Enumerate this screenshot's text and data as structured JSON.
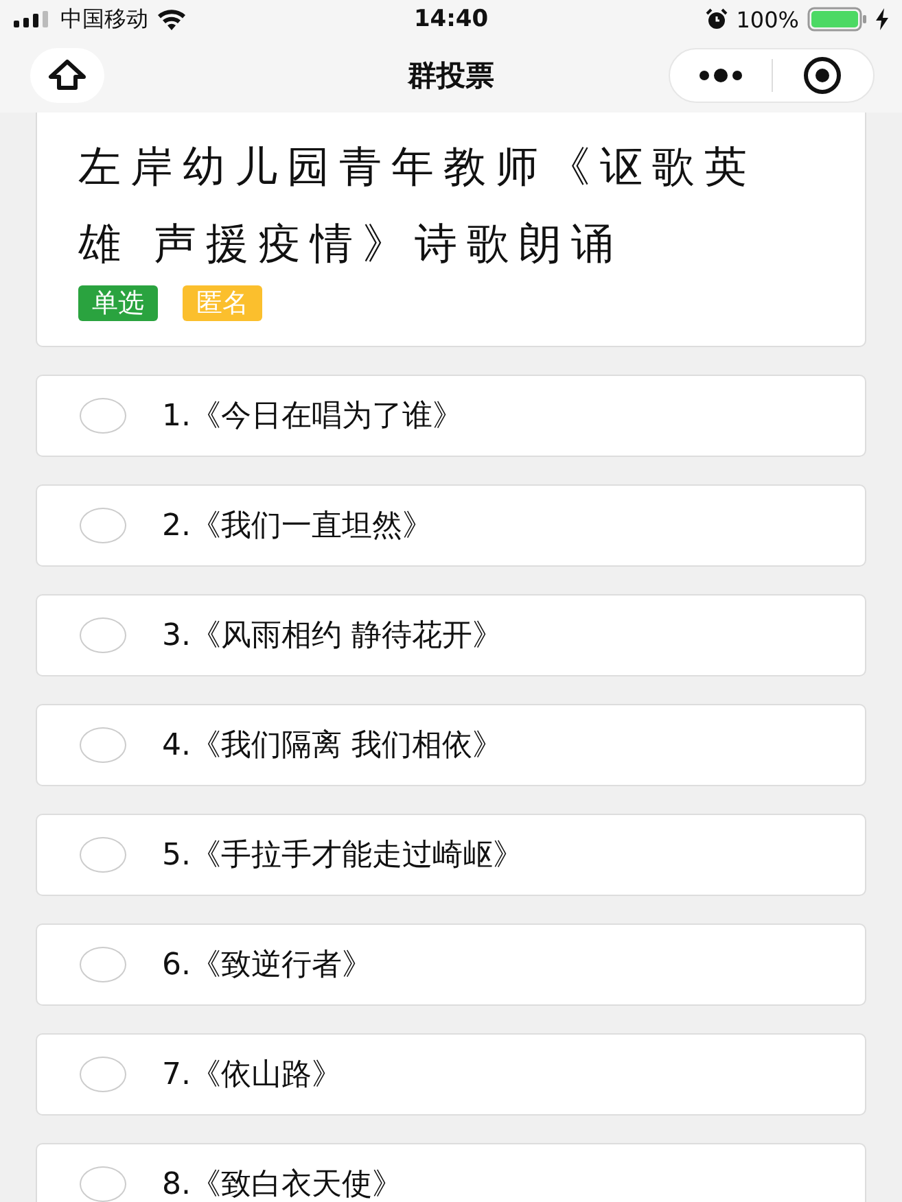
{
  "status_bar": {
    "carrier": "中国移动",
    "time": "14:40",
    "battery": "100%"
  },
  "nav": {
    "title": "群投票"
  },
  "poll": {
    "title": "左岸幼儿园青年教师《讴歌英雄 声援疫情》诗歌朗诵",
    "tags": [
      {
        "label": "单选",
        "color": "#2aa33f"
      },
      {
        "label": "匿名",
        "color": "#fbbf2d"
      }
    ]
  },
  "options": [
    {
      "label": "1.《今日在唱为了谁》",
      "selected": false
    },
    {
      "label": "2.《我们一直坦然》",
      "selected": false
    },
    {
      "label": "3.《风雨相约 静待花开》",
      "selected": false
    },
    {
      "label": "4.《我们隔离 我们相依》",
      "selected": false
    },
    {
      "label": "5.《手拉手才能走过崎岖》",
      "selected": false
    },
    {
      "label": "6.《致逆行者》",
      "selected": false
    },
    {
      "label": "7.《依山路》",
      "selected": false
    },
    {
      "label": "8.《致白衣天使》",
      "selected": false
    }
  ]
}
